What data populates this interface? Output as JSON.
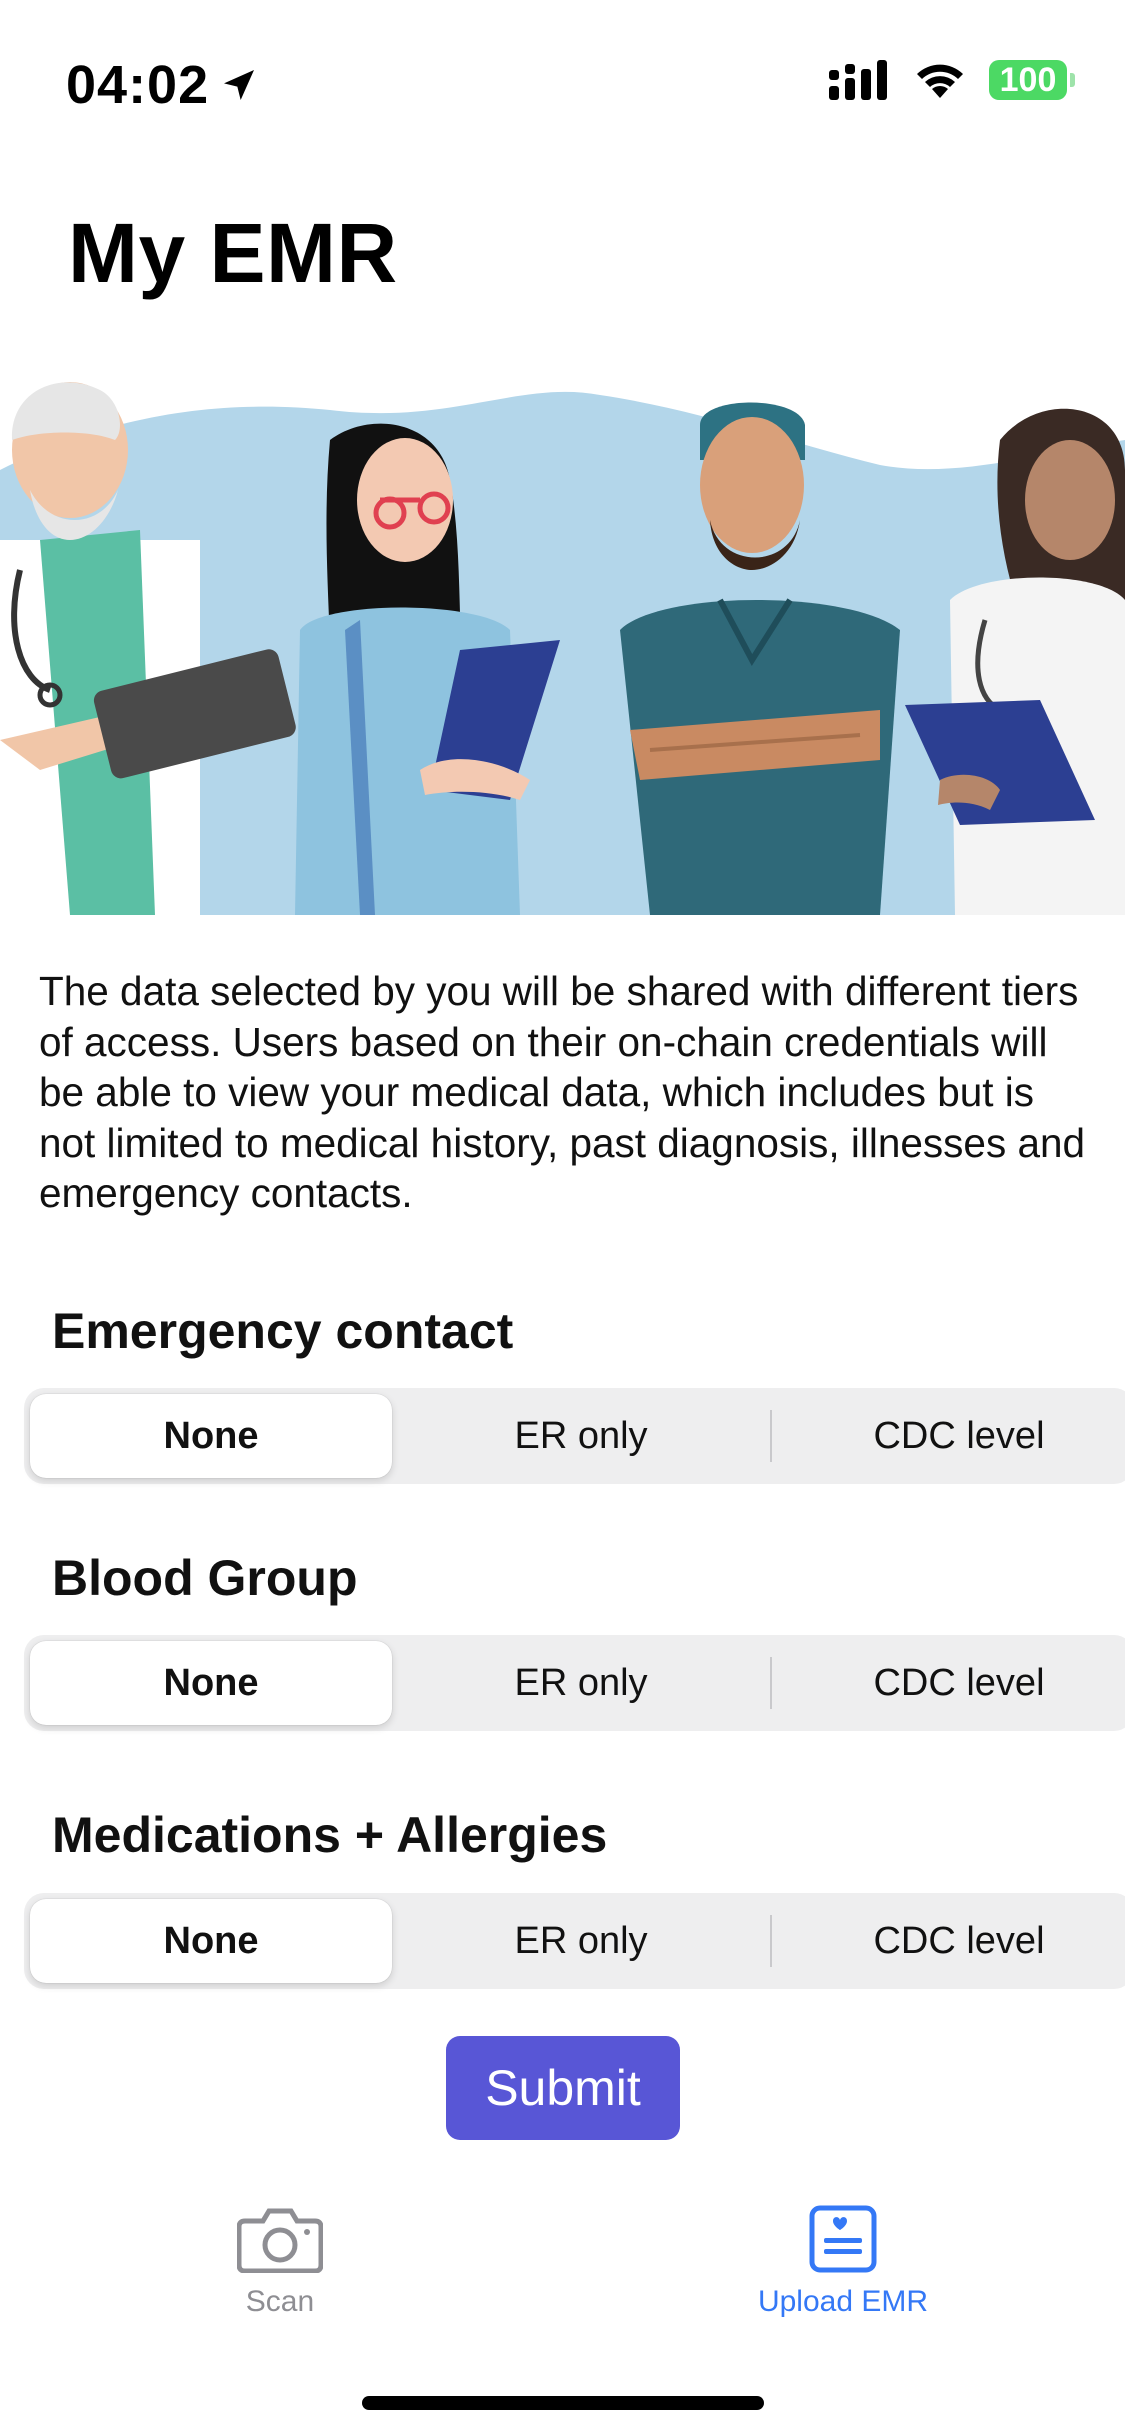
{
  "status_bar": {
    "time": "04:02",
    "battery": "100",
    "icons": [
      "location-arrow-icon",
      "cellular-signal-icon",
      "wifi-icon",
      "battery-icon"
    ]
  },
  "page_title": "My EMR",
  "hero_image": "doctors-illustration",
  "description": "The data selected by you will be shared with different tiers of access. Users based on their on-chain credentials will be able to view your medical data, which includes but is not limited to medical history, past diagnosis, illnesses and emergency contacts.",
  "sections": [
    {
      "label": "Emergency contact",
      "options": [
        "None",
        "ER only",
        "CDC level"
      ],
      "selected": "None"
    },
    {
      "label": "Blood Group",
      "options": [
        "None",
        "ER only",
        "CDC level"
      ],
      "selected": "None"
    },
    {
      "label": "Medications + Allergies",
      "options": [
        "None",
        "ER only",
        "CDC level"
      ],
      "selected": "None"
    }
  ],
  "submit_label": "Submit",
  "tab_bar": {
    "tabs": [
      {
        "label": "Scan",
        "icon": "camera-icon",
        "active": false
      },
      {
        "label": "Upload EMR",
        "icon": "medical-record-icon",
        "active": true
      }
    ]
  },
  "colors": {
    "accent": "#5856d6",
    "tab_active": "#3478f6",
    "tab_inactive": "#8e8e93",
    "battery": "#4cd964",
    "hero_sky": "#b3d6ea"
  }
}
